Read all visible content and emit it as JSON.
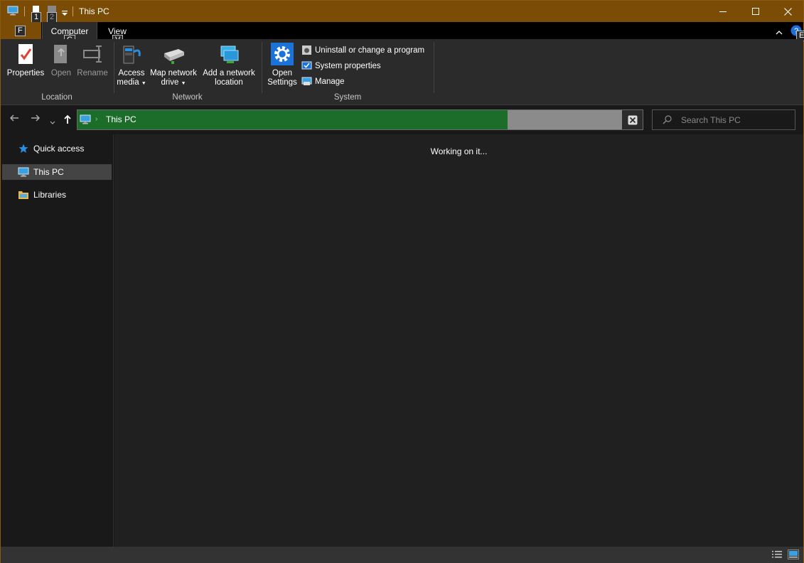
{
  "window": {
    "title": "This PC",
    "qat_keytips": [
      "1",
      "2"
    ],
    "help_keytip": "E"
  },
  "tabs": {
    "file_keytip": "F",
    "computer": {
      "label": "Computer",
      "keytip": "C"
    },
    "view": {
      "label": "View",
      "keytip": "V"
    }
  },
  "ribbon": {
    "location": {
      "label": "Location",
      "properties": "Properties",
      "open": "Open",
      "rename": "Rename"
    },
    "network": {
      "label": "Network",
      "access_media_line1": "Access",
      "access_media_line2": "media",
      "map_drive_line1": "Map network",
      "map_drive_line2": "drive",
      "add_location_line1": "Add a network",
      "add_location_line2": "location"
    },
    "system": {
      "label": "System",
      "open_settings_line1": "Open",
      "open_settings_line2": "Settings",
      "uninstall": "Uninstall or change a program",
      "system_properties": "System properties",
      "manage": "Manage"
    }
  },
  "address_bar": {
    "path": "This PC",
    "progress": 0.79
  },
  "search": {
    "placeholder": "Search This PC"
  },
  "nav_pane": {
    "items": [
      {
        "label": "Quick access",
        "icon": "star-icon"
      },
      {
        "label": "This PC",
        "icon": "computer-icon",
        "selected": true
      },
      {
        "label": "Libraries",
        "icon": "library-icon"
      }
    ]
  },
  "content": {
    "status": "Working on it..."
  },
  "colors": {
    "accent": "#7b4c06",
    "progress": "#1d6d2a"
  }
}
